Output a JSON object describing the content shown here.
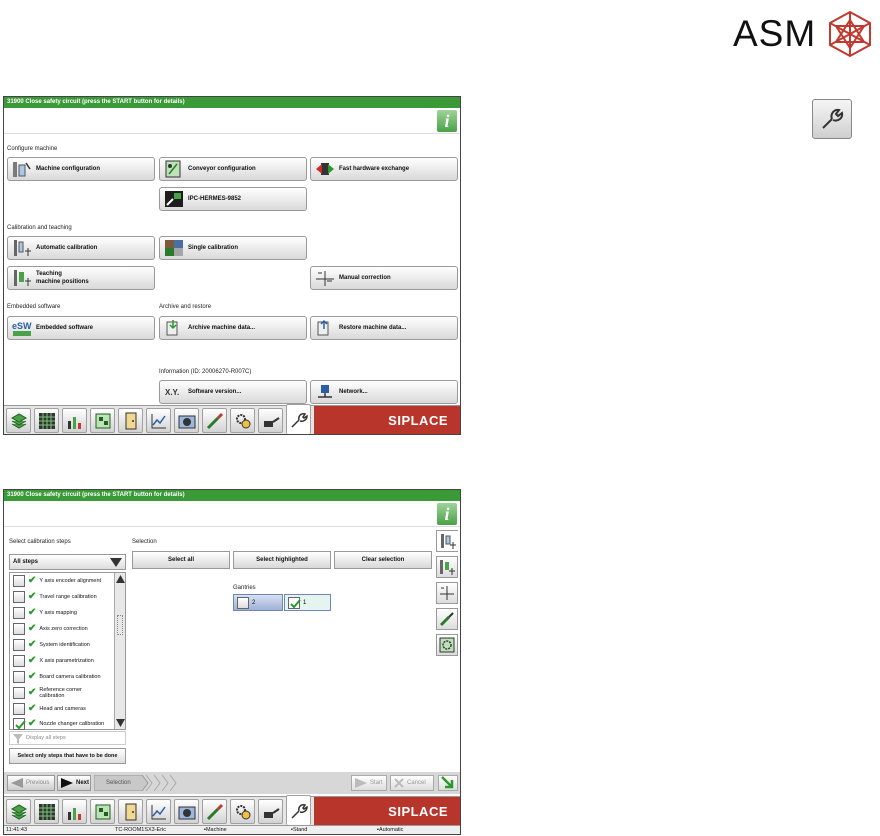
{
  "logo": {
    "text": "ASM"
  },
  "screen1": {
    "title": "31900 Close safety circuit (press the START button for details)",
    "sections": {
      "configure": "Configure machine",
      "calibration": "Calibration and teaching",
      "embedded": "Embedded software",
      "archive": "Archive and restore",
      "information": "Information (ID: 20006270-R007C)"
    },
    "buttons": {
      "machine_config": "Machine configuration",
      "conveyor_config": "Conveyor configuration",
      "fast_hw": "Fast hardware exchange",
      "ipc": "IPC-HERMES-9852",
      "auto_cal": "Automatic calibration",
      "single_cal": "Single calibration",
      "teach_1": "Teaching",
      "teach_2": "machine positions",
      "manual_corr": "Manual correction",
      "embedded_sw": "Embedded software",
      "archive": "Archive machine data...",
      "restore": "Restore machine data...",
      "sw_version": "Software version...",
      "network": "Network..."
    },
    "brand": "SIPLACE"
  },
  "screen2": {
    "title": "31900 Close safety circuit (press the START button for details)",
    "select_steps_label": "Select calibration steps",
    "selection_label": "Selection",
    "dropdown_value": "All steps",
    "steps": [
      {
        "label": "Y axis encoder alignment",
        "checked": false
      },
      {
        "label": "Travel range calibration",
        "checked": false
      },
      {
        "label": "Y axis mapping",
        "checked": false
      },
      {
        "label": "Axis zero correction",
        "checked": false
      },
      {
        "label": "System identification",
        "checked": false
      },
      {
        "label": "X axis parametrization",
        "checked": false
      },
      {
        "label": "Board camera calibration",
        "checked": false
      },
      {
        "label": "Reference corner",
        "label2": "calibration",
        "checked": false
      },
      {
        "label": "Head and cameras",
        "checked": false
      },
      {
        "label": "Nozzle changer calibration",
        "checked": true
      }
    ],
    "display_all": "Display all steps",
    "only_required": "Select only steps that have to be done",
    "select_all": "Select all",
    "select_highlighted": "Select highlighted",
    "clear_selection": "Clear selection",
    "gantries_label": "Gantries",
    "gantry_2": "2",
    "gantry_1": "1",
    "previous": "Previous",
    "next": "Next",
    "crumb_selection": "Selection",
    "start": "Start",
    "cancel": "Cancel",
    "brand": "SIPLACE",
    "status": {
      "time": "11:41:43",
      "station": "TC-ROOM1SX3-Eric",
      "mode1": "Machine service",
      "mode2": "Stand alone",
      "mode3": "Automatic mode"
    }
  }
}
